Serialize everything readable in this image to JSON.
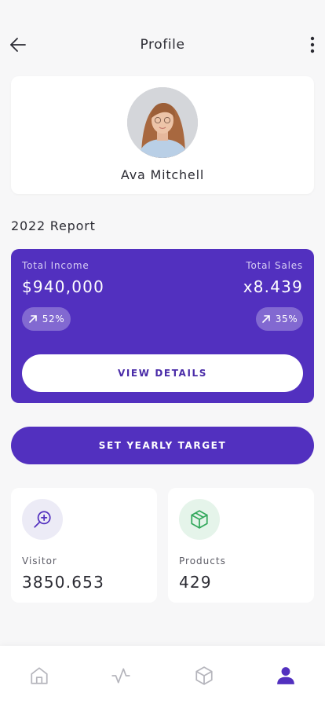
{
  "header": {
    "title": "Profile",
    "back_icon": "arrow-left-icon",
    "more_icon": "more-vertical-icon"
  },
  "profile": {
    "name": "Ava Mitchell",
    "avatar_icon": "user-photo"
  },
  "report": {
    "section_title": "2022 Report",
    "income_label": "Total Income",
    "income_value": "$940,000",
    "income_change": "52%",
    "sales_label": "Total Sales",
    "sales_value": "x8.439",
    "sales_change": "35%",
    "view_details_label": "VIEW DETAILS",
    "trend_icon": "arrow-up-right-icon"
  },
  "target_button_label": "SET YEARLY TARGET",
  "stats": [
    {
      "label": "Visitor",
      "value": "3850.653",
      "icon": "zoom-in-icon"
    },
    {
      "label": "Products",
      "value": "429",
      "icon": "box-icon"
    }
  ],
  "bottom_nav": [
    {
      "icon": "home-icon"
    },
    {
      "icon": "activity-icon"
    },
    {
      "icon": "box-icon"
    },
    {
      "icon": "user-icon",
      "active": true
    }
  ],
  "colors": {
    "primary": "#5230bf",
    "background": "#f7f7f8",
    "card": "#ffffff",
    "text": "#2b2b33",
    "green_icon": "#33a85c",
    "inactive_nav": "#b5b5bc"
  }
}
